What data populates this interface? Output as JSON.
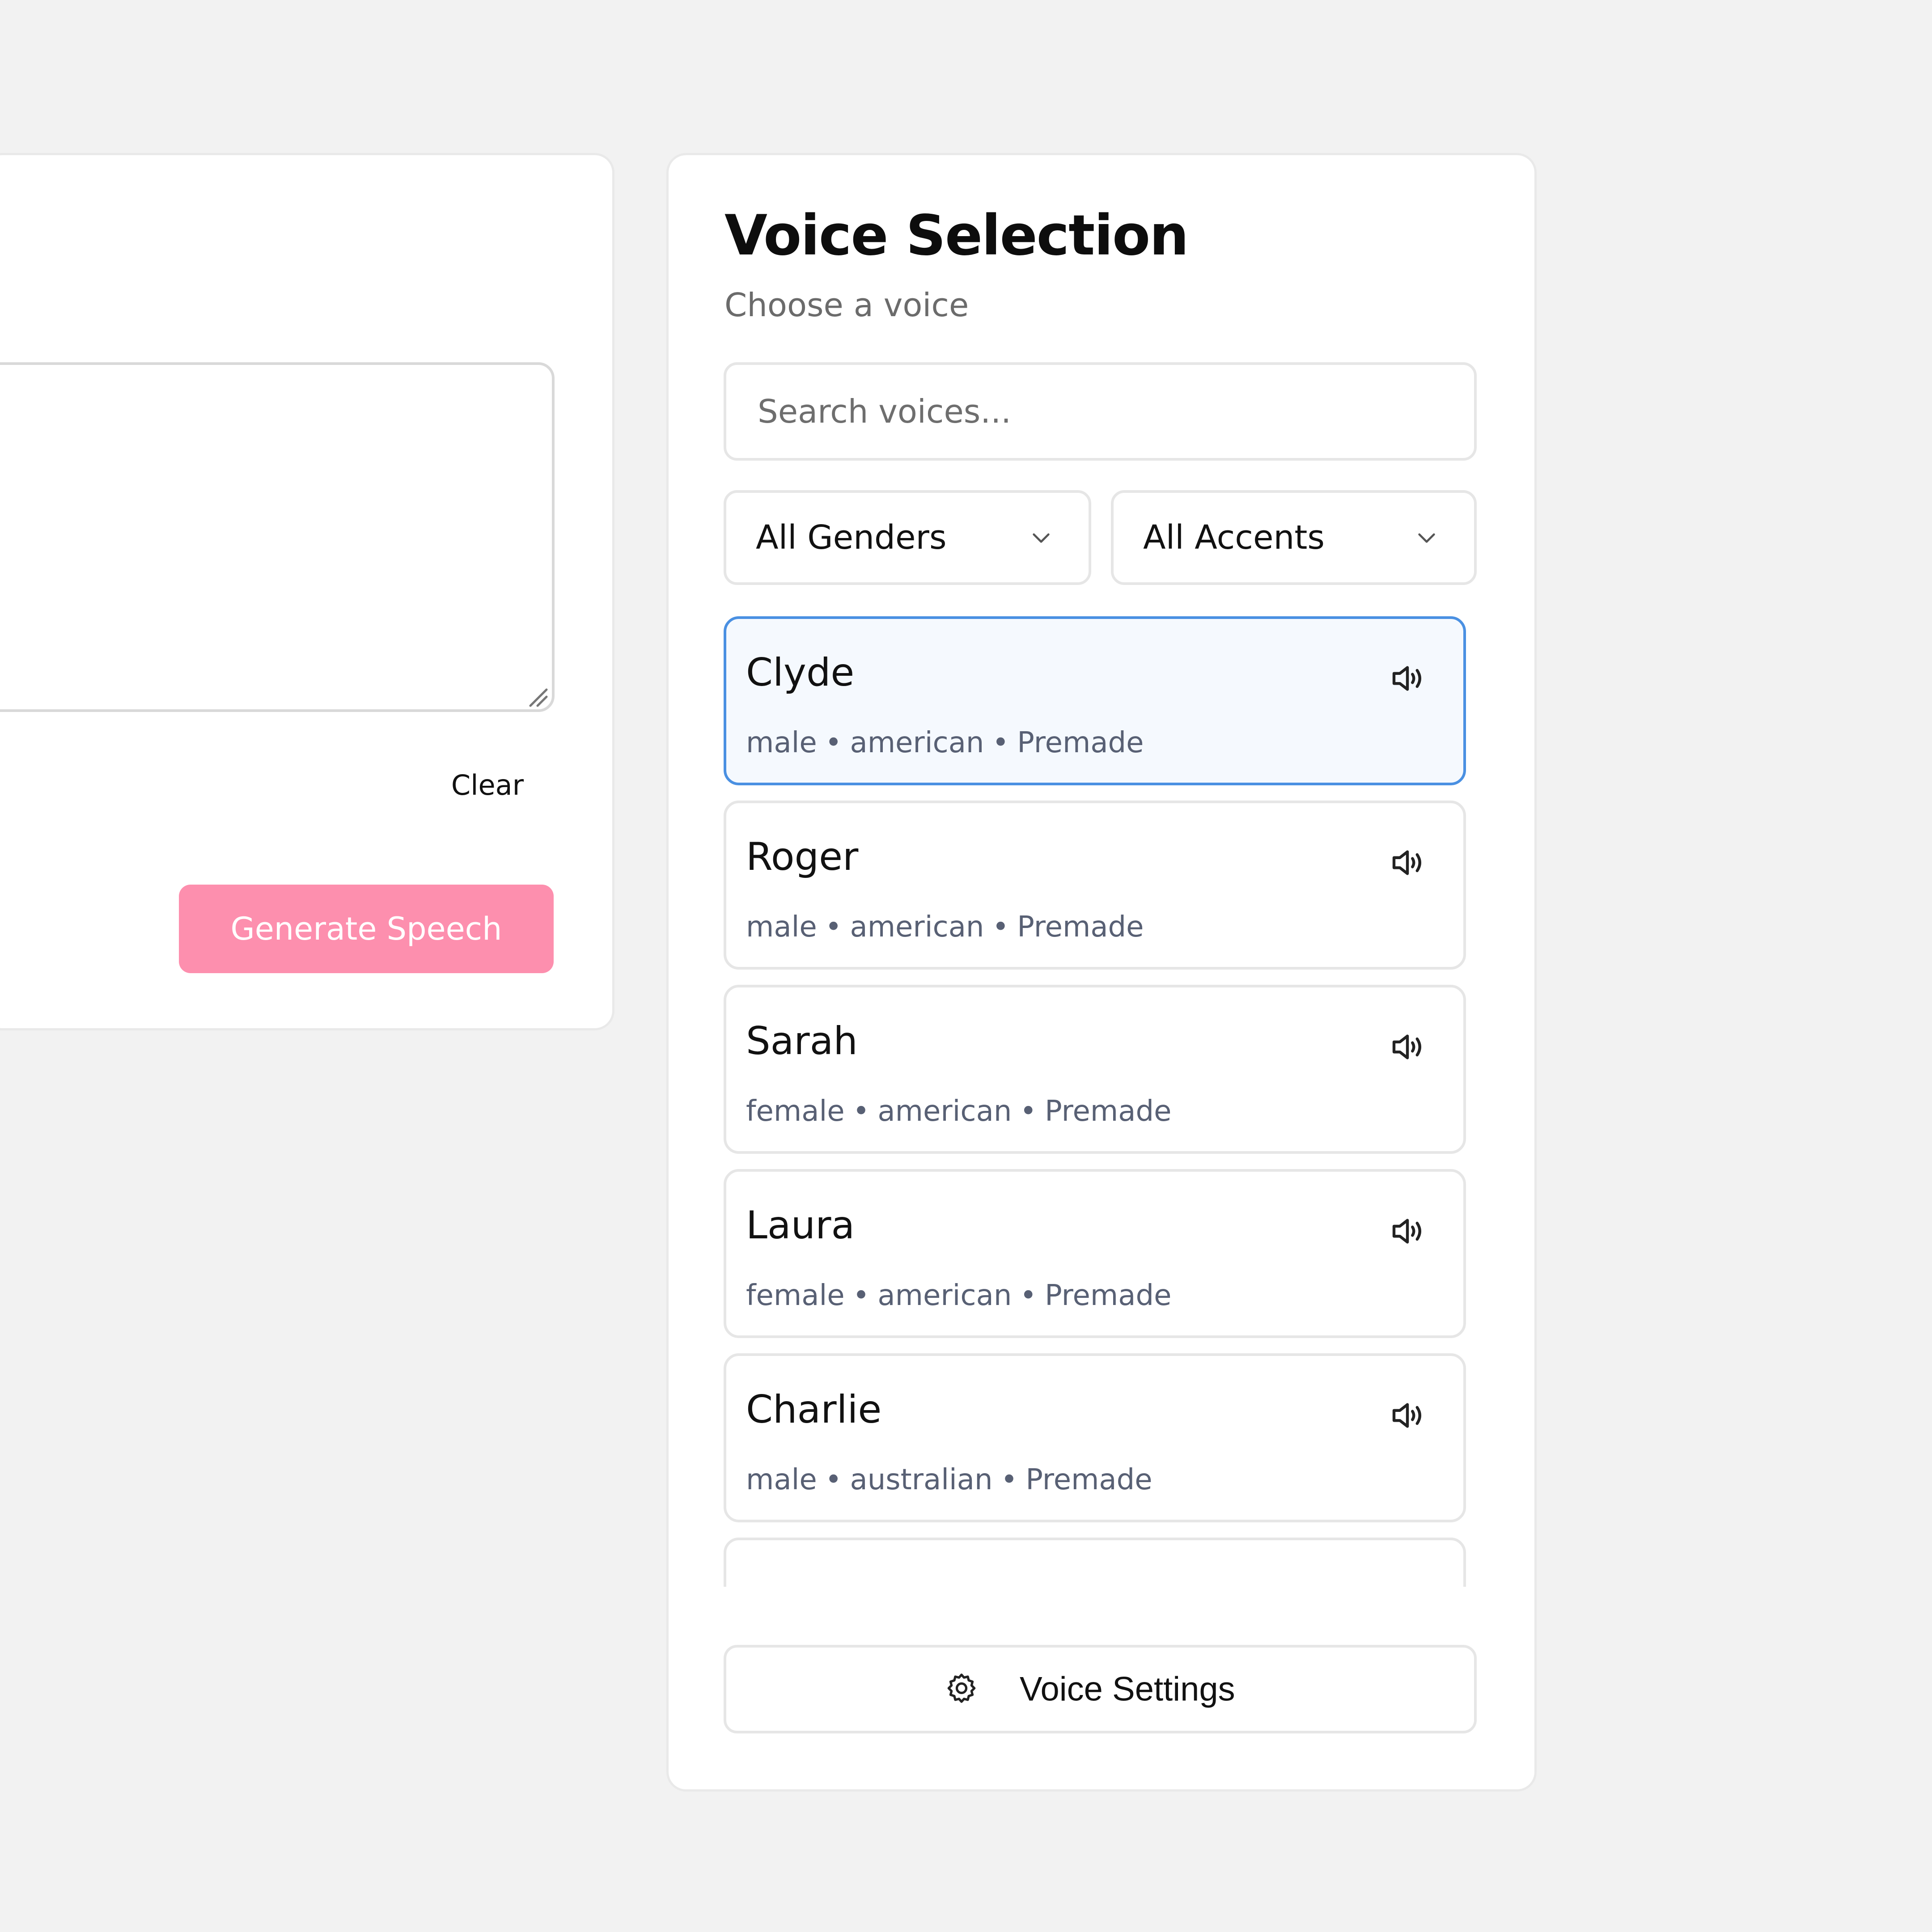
{
  "editor": {
    "text_value": "",
    "clear_label": "Clear",
    "generate_label": "Generate Speech"
  },
  "voice_panel": {
    "title": "Voice Selection",
    "subtitle": "Choose a voice",
    "search_placeholder": "Search voices...",
    "gender_filter": "All Genders",
    "accent_filter": "All Accents",
    "settings_label": "Voice Settings"
  },
  "voices": [
    {
      "name": "Clyde",
      "gender": "male",
      "accent": "american",
      "category": "Premade",
      "selected": true
    },
    {
      "name": "Roger",
      "gender": "male",
      "accent": "american",
      "category": "Premade",
      "selected": false
    },
    {
      "name": "Sarah",
      "gender": "female",
      "accent": "american",
      "category": "Premade",
      "selected": false
    },
    {
      "name": "Laura",
      "gender": "female",
      "accent": "american",
      "category": "Premade",
      "selected": false
    },
    {
      "name": "Charlie",
      "gender": "male",
      "accent": "australian",
      "category": "Premade",
      "selected": false
    }
  ],
  "colors": {
    "accent_pink": "#fd8fae",
    "selected_border": "#4a90e2",
    "selected_bg": "#f5f9fe"
  },
  "icons": {
    "select_arrow": "chevron-down-icon",
    "preview": "speaker-icon",
    "settings": "gear-icon"
  }
}
